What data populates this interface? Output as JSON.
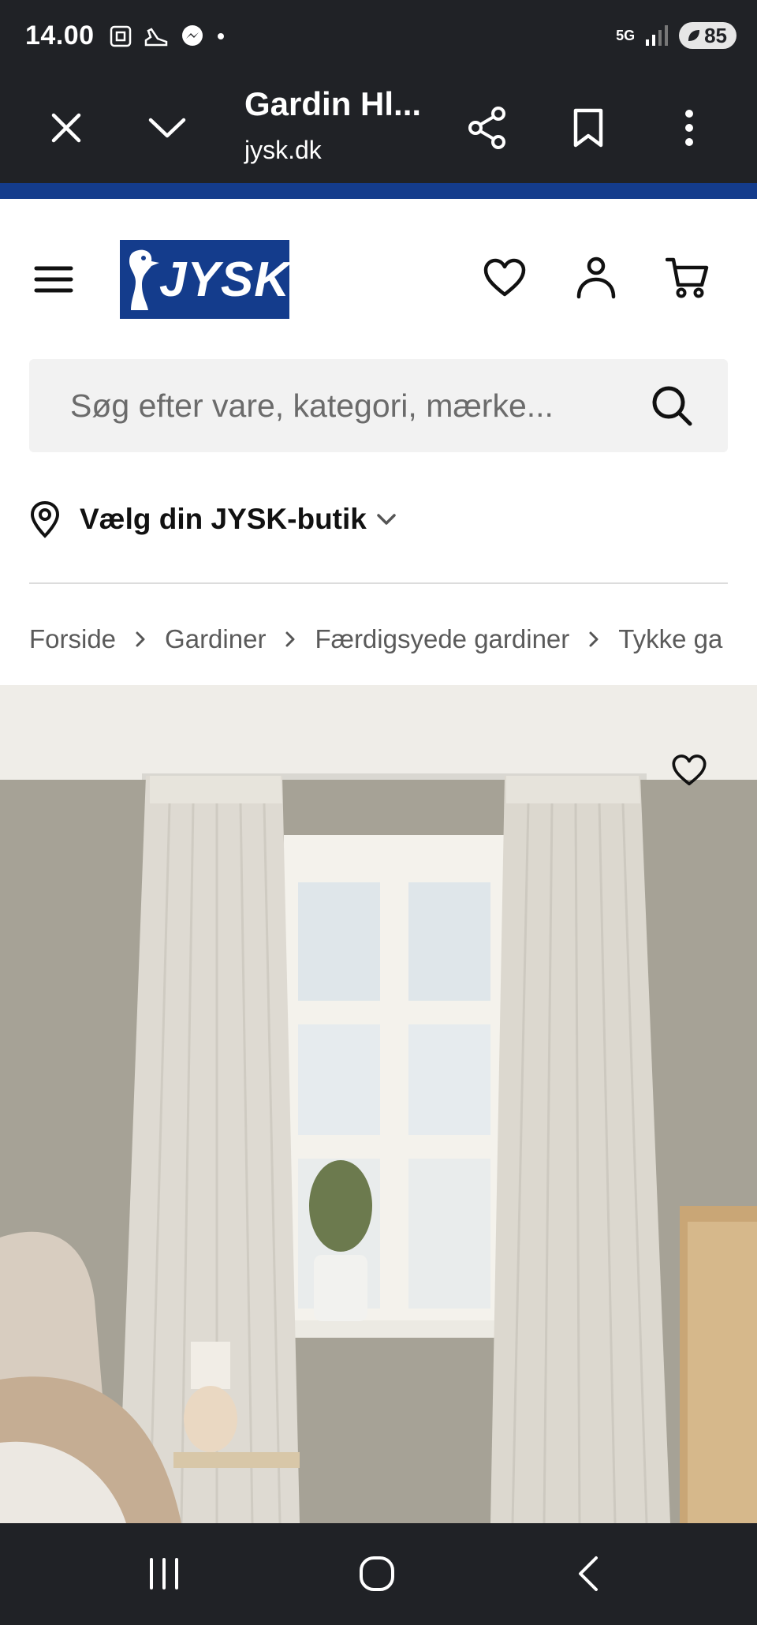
{
  "status_bar": {
    "time": "14.00",
    "network": "5G",
    "battery": "85"
  },
  "browser": {
    "page_title": "Gardin Hl...",
    "domain": "jysk.dk"
  },
  "header": {
    "logo_text": "JYSK",
    "brand_color": "#143c8c"
  },
  "search": {
    "placeholder": "Søg efter vare, kategori, mærke..."
  },
  "store": {
    "label": "Vælg din JYSK-butik"
  },
  "breadcrumb": {
    "items": [
      "Forside",
      "Gardiner",
      "Færdigsyede gardiner",
      "Tykke ga"
    ]
  },
  "icons": {
    "close": "close-icon",
    "collapse": "chevron-down-icon",
    "share": "share-icon",
    "bookmark": "bookmark-icon",
    "more": "more-vertical-icon",
    "menu": "hamburger-menu-icon",
    "wishlist": "heart-icon",
    "account": "user-icon",
    "cart": "cart-icon",
    "search": "search-icon",
    "location": "location-pin-icon"
  }
}
